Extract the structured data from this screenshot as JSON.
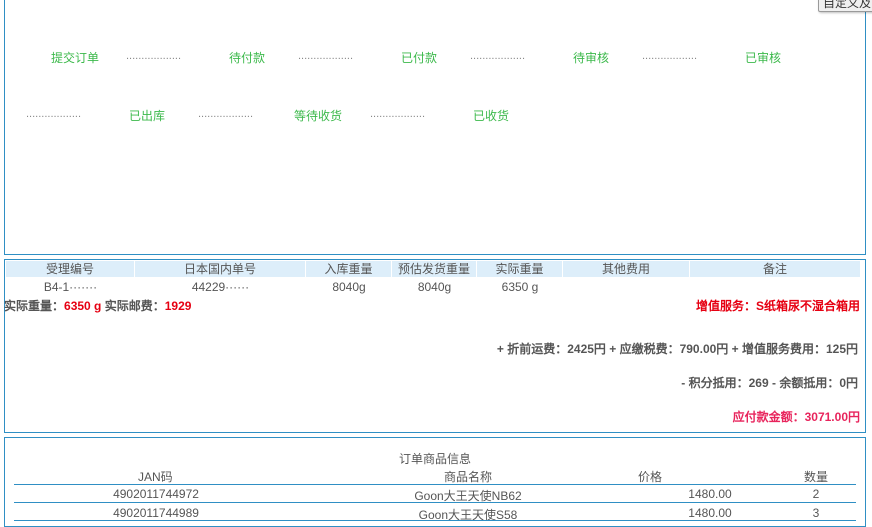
{
  "tooltip": {
    "text": "自定义及"
  },
  "status_steps": [
    {
      "label": "提交订单"
    },
    {
      "label": "待付款"
    },
    {
      "label": "已付款"
    },
    {
      "label": "待审核"
    },
    {
      "label": "已审核"
    },
    {
      "label": "已出库"
    },
    {
      "label": "等待收货"
    },
    {
      "label": "已收货"
    }
  ],
  "separator_dots": "..................",
  "weight_table": {
    "headers": [
      "受理编号",
      "日本国内单号",
      "入库重量",
      "预估发货重量",
      "实际重量",
      "其他费用",
      "备注"
    ],
    "row": [
      "B4-1·······",
      "44229······",
      "8040g",
      "8040g",
      "6350 g",
      "",
      ""
    ]
  },
  "summary": {
    "actual_weight_label": "实际重量：",
    "actual_weight_value": "6350 g",
    "actual_postage_label": "实际邮费：",
    "actual_postage_value": "1929",
    "value_added_service": "增值服务：S纸箱尿不湿合箱用",
    "fee_line": "+ 折前运费：2425円 + 应缴税费：790.00円 + 增值服务费用：125円",
    "deduction_line": "- 积分抵用：269 - 余额抵用：0円",
    "payable_line": "应付款金额：3071.00円"
  },
  "goods": {
    "title": "订单商品信息",
    "headers": {
      "jan": "JAN码",
      "name": "商品名称",
      "price": "价格",
      "qty": "数量"
    },
    "rows": [
      {
        "jan": "4902011744972",
        "name": "Goon大王天使NB62",
        "price": "1480.00",
        "qty": "2"
      },
      {
        "jan": "4902011744989",
        "name": "Goon大王天使S58",
        "price": "1480.00",
        "qty": "3"
      }
    ]
  }
}
